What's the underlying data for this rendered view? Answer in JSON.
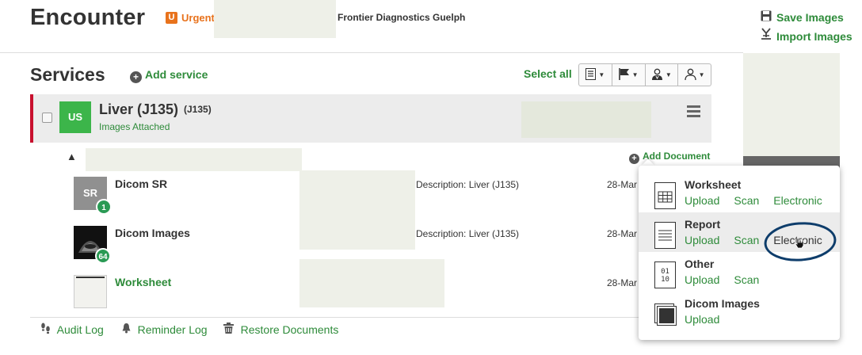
{
  "header": {
    "title": "Encounter",
    "urgent_badge": "U",
    "urgent_label": "Urgent",
    "facility": "Frontier Diagnostics Guelph",
    "save_images": "Save Images",
    "import_images": "Import Images"
  },
  "services": {
    "title": "Services",
    "add_service": "Add service",
    "select_all": "Select all",
    "toolbar": [
      {
        "icon": "document-list-icon"
      },
      {
        "icon": "flag-icon"
      },
      {
        "icon": "doctor-icon"
      },
      {
        "icon": "user-icon"
      }
    ]
  },
  "service": {
    "modality": "US",
    "name": "Liver (J135)",
    "code": "(J135)",
    "status": "Images Attached"
  },
  "documents": {
    "add_document": "Add Document",
    "items": [
      {
        "thumb": "SR",
        "count": "1",
        "name": "Dicom SR",
        "description": "Description: Liver (J135)",
        "date": "28-Mar"
      },
      {
        "thumb": "",
        "count": "64",
        "name": "Dicom Images",
        "description": "Description: Liver (J135)",
        "date": "28-Mar"
      },
      {
        "thumb": "",
        "count": "",
        "name": "Worksheet",
        "description": "",
        "date": "28-Mar"
      }
    ]
  },
  "footer": {
    "audit_log": "Audit Log",
    "reminder_log": "Reminder Log",
    "restore_documents": "Restore Documents"
  },
  "popup": {
    "rows": [
      {
        "title": "Worksheet",
        "actions": [
          "Upload",
          "Scan",
          "Electronic"
        ]
      },
      {
        "title": "Report",
        "actions": [
          "Upload",
          "Scan",
          "Electronic"
        ]
      },
      {
        "title": "Other",
        "actions": [
          "Upload",
          "Scan"
        ],
        "icon_text": "01\n10"
      },
      {
        "title": "Dicom Images",
        "actions": [
          "Upload"
        ]
      }
    ]
  },
  "colors": {
    "accent_green": "#2e8b3a",
    "urgent_orange": "#e8721c",
    "service_red": "#c8102e",
    "modality_green": "#3cb54a"
  }
}
